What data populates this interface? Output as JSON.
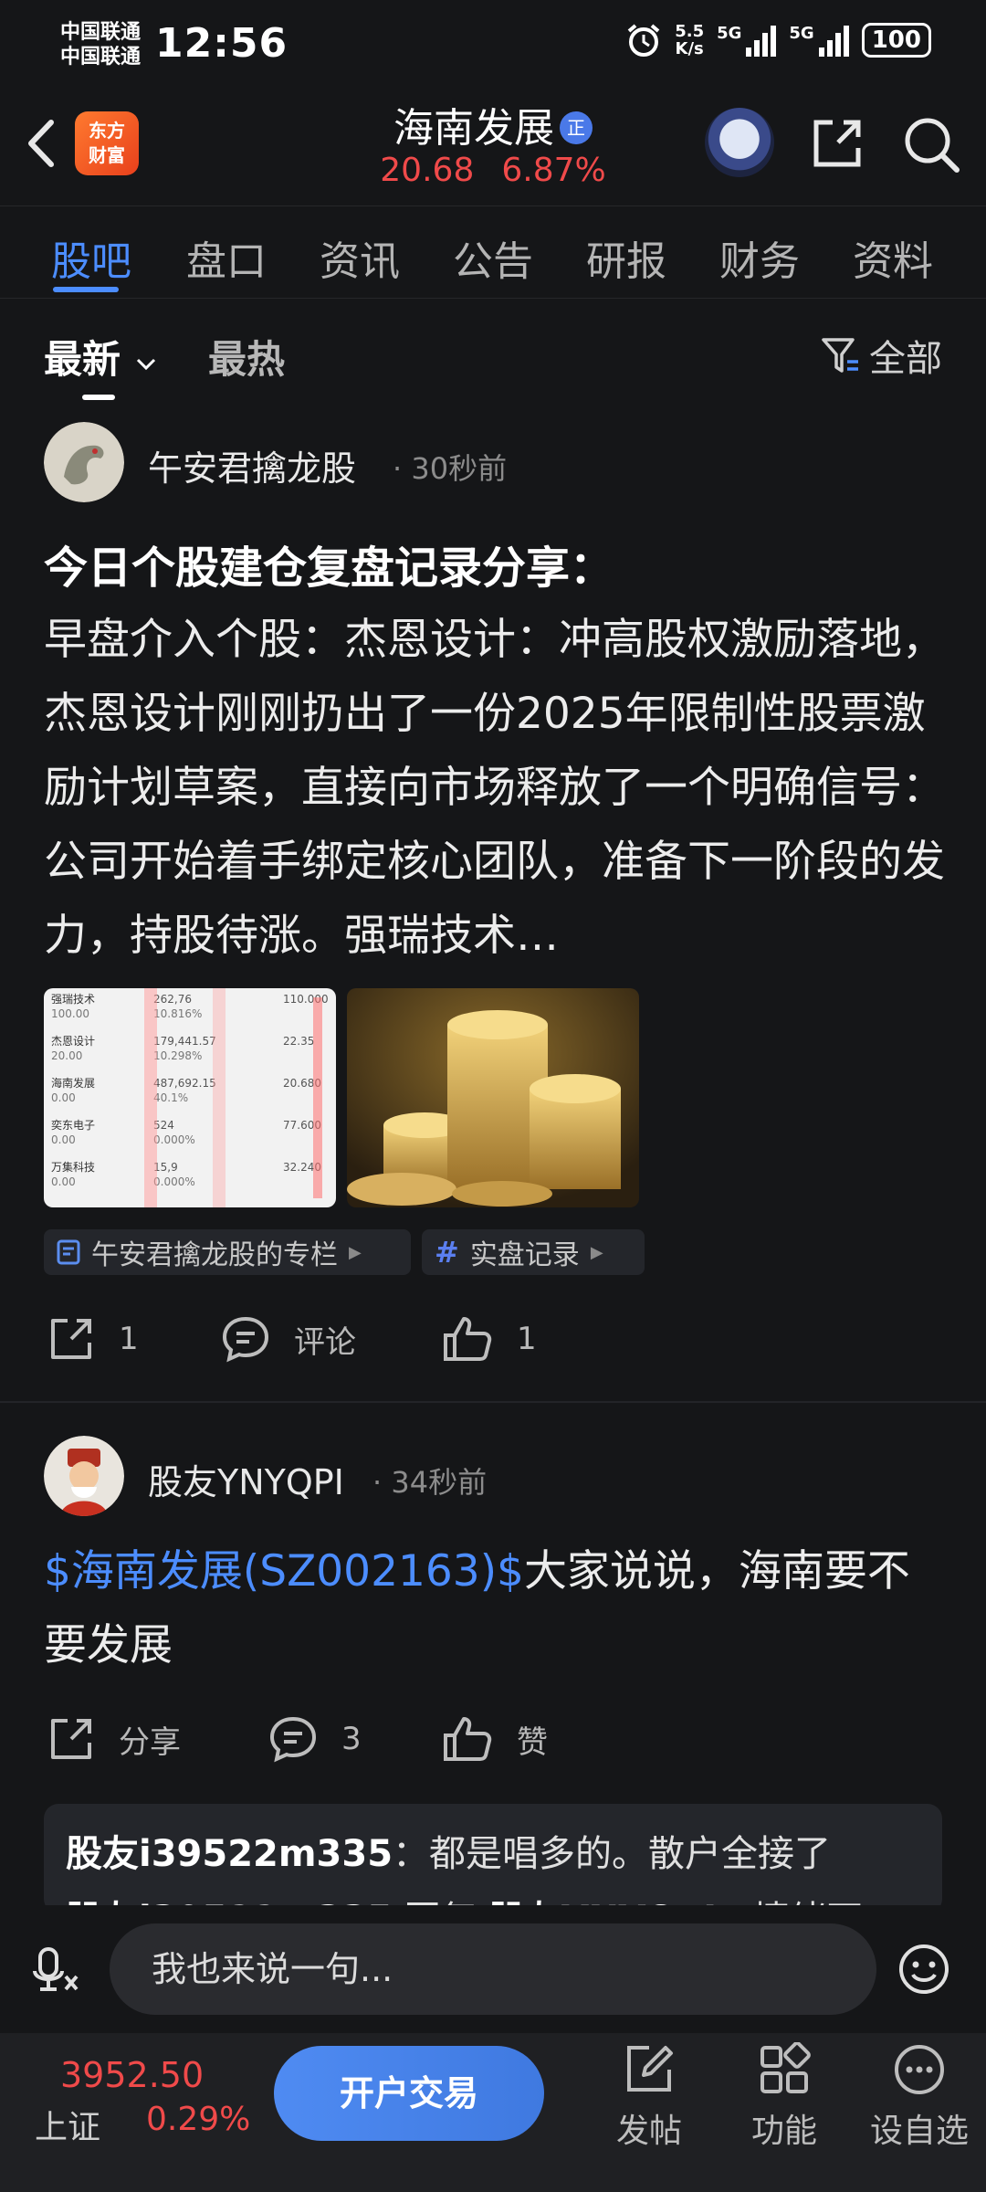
{
  "status_bar": {
    "carrier1": "中国联通",
    "carrier2": "中国联通",
    "time": "12:56",
    "net_speed_top": "5.5",
    "net_speed_bottom": "K/s",
    "sig1_label": "5G",
    "sig2_label": "5G",
    "battery": "100"
  },
  "header": {
    "logo_line1": "东方",
    "logo_line2": "财富",
    "stock_name": "海南发展",
    "badge": "正",
    "price": "20.68",
    "change_pct": "6.87%"
  },
  "tabs": [
    "股吧",
    "盘口",
    "资讯",
    "公告",
    "研报",
    "财务",
    "资料"
  ],
  "sort": {
    "latest": "最新",
    "hot": "最热",
    "filter": "全部"
  },
  "post1": {
    "user": "午安君擒龙股",
    "time": "· 30秒前",
    "title": "今日个股建仓复盘记录分享：",
    "body": "早盘介入个股：杰恩设计：冲高股权激励落地，杰恩设计刚刚扔出了一份2025年限制性股票激励计划草案，直接向市场释放了一个明确信号：公司开始着手绑定核心团队，准备下一阶段的发力，持股待涨。强瑞技术…",
    "tag_column": "午安君擒龙股的专栏",
    "tag_topic": "实盘记录",
    "share_count": "1",
    "comment_label": "评论",
    "like_count": "1",
    "thumb_rows": [
      {
        "name": "强瑞技术",
        "a": "100.00",
        "b": "262,76",
        "c": "10.816%",
        "d": "110.000"
      },
      {
        "name": "杰恩设计",
        "a": "20.00",
        "b": "179,441.57",
        "c": "10.298%",
        "d": "22.35"
      },
      {
        "name": "海南发展",
        "a": "0.00",
        "b": "487,692.15",
        "c": "40.1%",
        "d": "20.680"
      },
      {
        "name": "奕东电子",
        "a": "0.00",
        "b": "524",
        "c": "0.000%",
        "d": "77.600"
      },
      {
        "name": "万集科技",
        "a": "0.00",
        "b": "15,9",
        "c": "0.000%",
        "d": "32.240"
      }
    ]
  },
  "post2": {
    "user": "股友YNYQPI",
    "time": "· 34秒前",
    "link": "$海南发展(SZ002163)$",
    "body": "大家说说，海南要不要发展",
    "share_label": "分享",
    "comment_count": "3",
    "like_label": "赞",
    "reply_user": "股友i39522m335",
    "reply_text": "：都是唱多的。散户全接了",
    "reply2_user": "股友i39522m335",
    "reply2_mid": "回复",
    "reply2_target": "股友YNYQPI",
    "reply2_text": "：情绪不"
  },
  "comment_bar": {
    "placeholder": "我也来说一句..."
  },
  "bottom_nav": {
    "index_value": "3952.50",
    "index_name": "上证",
    "index_pct": "0.29%",
    "trade": "开户交易",
    "post": "发帖",
    "func": "功能",
    "watch": "设自选"
  },
  "colors": {
    "accent": "#4c8dff",
    "up": "#f04a4a",
    "bg": "#151618"
  }
}
